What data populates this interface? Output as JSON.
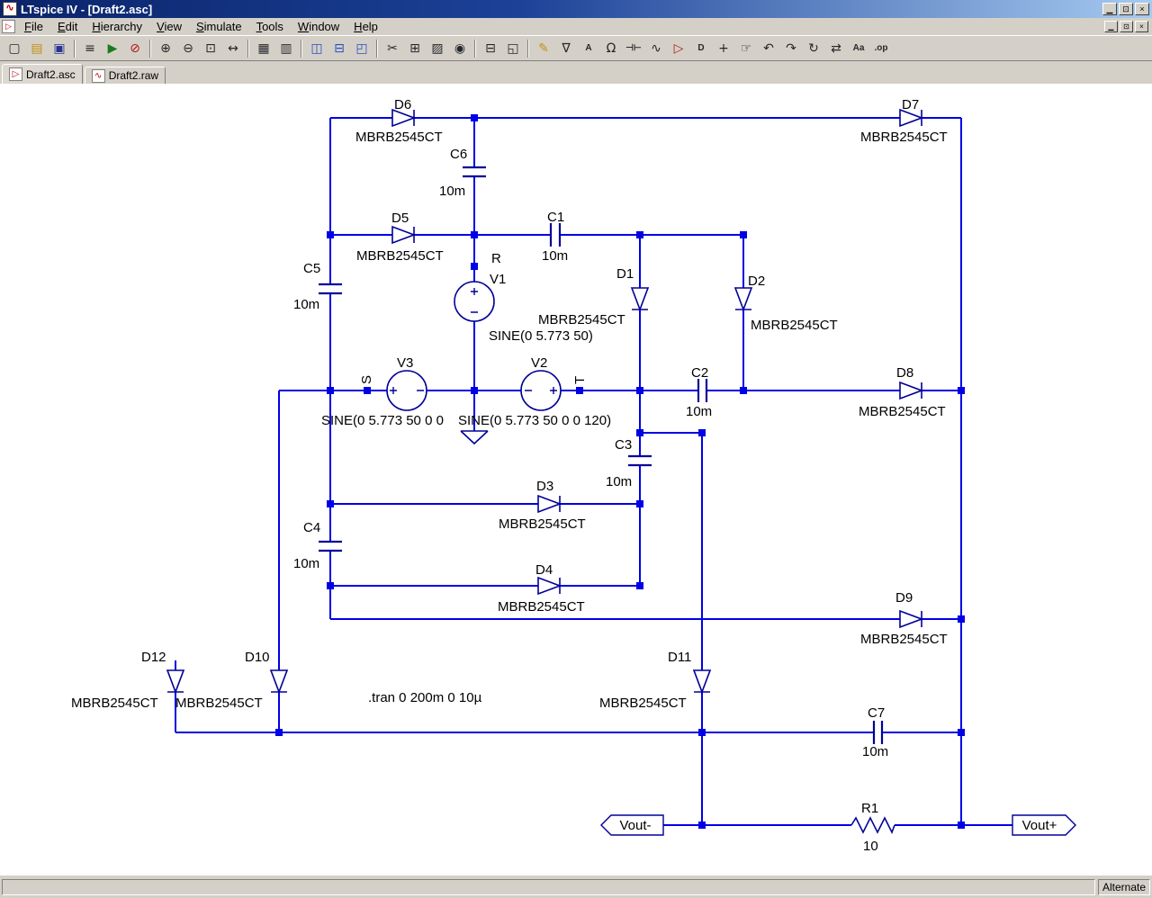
{
  "window": {
    "title": "LTspice IV - [Draft2.asc]",
    "controls": {
      "minimize": "▁",
      "restore": "⊡",
      "close": "×"
    }
  },
  "menu": {
    "items": [
      "File",
      "Edit",
      "Hierarchy",
      "View",
      "Simulate",
      "Tools",
      "Window",
      "Help"
    ]
  },
  "toolbar": {
    "icons": [
      {
        "name": "new-schematic",
        "glyph": "▢"
      },
      {
        "name": "open",
        "glyph": "▤"
      },
      {
        "name": "save",
        "glyph": "▣"
      },
      {
        "name": "control-panel",
        "glyph": "≡"
      },
      {
        "name": "run",
        "glyph": "▶"
      },
      {
        "name": "halt",
        "glyph": "⊘"
      },
      {
        "name": "zoom-area",
        "glyph": "⊕"
      },
      {
        "name": "zoom-back",
        "glyph": "⊖"
      },
      {
        "name": "zoom-fit",
        "glyph": "⊡"
      },
      {
        "name": "pan",
        "glyph": "↔"
      },
      {
        "name": "grid",
        "glyph": "▦"
      },
      {
        "name": "waveform-panes",
        "glyph": "▥"
      },
      {
        "name": "tile-vertical",
        "glyph": "◫"
      },
      {
        "name": "tile-horizontal",
        "glyph": "⊟"
      },
      {
        "name": "cascade",
        "glyph": "◰"
      },
      {
        "name": "cut",
        "glyph": "✂"
      },
      {
        "name": "copy",
        "glyph": "⊞"
      },
      {
        "name": "paste",
        "glyph": "▨"
      },
      {
        "name": "find",
        "glyph": "◉"
      },
      {
        "name": "print",
        "glyph": "⊟"
      },
      {
        "name": "print-preview",
        "glyph": "◱"
      },
      {
        "name": "wire",
        "glyph": "✎"
      },
      {
        "name": "ground",
        "glyph": "∇"
      },
      {
        "name": "net-label",
        "glyph": "A"
      },
      {
        "name": "resistor",
        "glyph": "Ω"
      },
      {
        "name": "capacitor",
        "glyph": "⊣⊢"
      },
      {
        "name": "inductor",
        "glyph": "∿"
      },
      {
        "name": "diode",
        "glyph": "▷"
      },
      {
        "name": "component",
        "glyph": "D"
      },
      {
        "name": "move",
        "glyph": "+"
      },
      {
        "name": "drag",
        "glyph": "☞"
      },
      {
        "name": "undo",
        "glyph": "↶"
      },
      {
        "name": "redo",
        "glyph": "↷"
      },
      {
        "name": "rotate",
        "glyph": "↻"
      },
      {
        "name": "mirror",
        "glyph": "⇄"
      },
      {
        "name": "text",
        "glyph": "Aa"
      },
      {
        "name": "spice-directive",
        "glyph": ".op"
      }
    ]
  },
  "tabs": [
    {
      "label": "Draft2.asc",
      "icon": "▷"
    },
    {
      "label": "Draft2.raw",
      "icon": "∿"
    }
  ],
  "schematic": {
    "directive": ".tran 0 200m 0 10µ",
    "nets": {
      "r": "R",
      "s": "S",
      "t": "T"
    },
    "ports": {
      "vout_minus": "Vout-",
      "vout_plus": "Vout+"
    },
    "parts": {
      "D1": {
        "ref": "D1",
        "value": "MBRB2545CT"
      },
      "D2": {
        "ref": "D2",
        "value": "MBRB2545CT"
      },
      "D3": {
        "ref": "D3",
        "value": "MBRB2545CT"
      },
      "D4": {
        "ref": "D4",
        "value": "MBRB2545CT"
      },
      "D5": {
        "ref": "D5",
        "value": "MBRB2545CT"
      },
      "D6": {
        "ref": "D6",
        "value": "MBRB2545CT"
      },
      "D7": {
        "ref": "D7",
        "value": "MBRB2545CT"
      },
      "D8": {
        "ref": "D8",
        "value": "MBRB2545CT"
      },
      "D9": {
        "ref": "D9",
        "value": "MBRB2545CT"
      },
      "D10": {
        "ref": "D10",
        "value": "MBRB2545CT"
      },
      "D11": {
        "ref": "D11",
        "value": "MBRB2545CT"
      },
      "D12": {
        "ref": "D12",
        "value": "MBRB2545CT"
      },
      "C1": {
        "ref": "C1",
        "value": "10m"
      },
      "C2": {
        "ref": "C2",
        "value": "10m"
      },
      "C3": {
        "ref": "C3",
        "value": "10m"
      },
      "C4": {
        "ref": "C4",
        "value": "10m"
      },
      "C5": {
        "ref": "C5",
        "value": "10m"
      },
      "C6": {
        "ref": "C6",
        "value": "10m"
      },
      "C7": {
        "ref": "C7",
        "value": "10m"
      },
      "V1": {
        "ref": "V1",
        "value": "SINE(0 5.773 50)"
      },
      "V2": {
        "ref": "V2",
        "value": "SINE(0 5.773 50 0 0 120)"
      },
      "V3": {
        "ref": "V3",
        "value": "SINE(0 5.773 50 0 0"
      },
      "R1": {
        "ref": "R1",
        "value": "10"
      }
    }
  },
  "statusbar": {
    "mode": "Alternate"
  },
  "colors": {
    "wire": "#0000E6",
    "symbol": "#000096",
    "junction": "#0000E6",
    "canvas": "#FFFFFF",
    "chrome": "#D4D0C8",
    "titlebar_left": "#0A246A",
    "titlebar_right": "#A6CAF0"
  }
}
